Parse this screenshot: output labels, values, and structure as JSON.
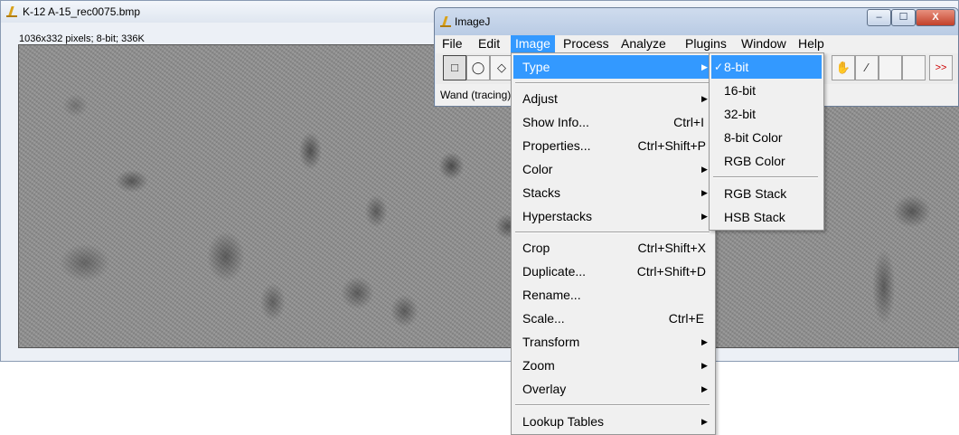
{
  "image_window": {
    "title": "K-12 A-15_rec0075.bmp",
    "info": "1036x332 pixels; 8-bit; 336K"
  },
  "imagej_window": {
    "title": "ImageJ",
    "controls": {
      "minimize": "–",
      "maximize": "☐",
      "close": "X"
    },
    "menu": [
      "File",
      "Edit",
      "Image",
      "Process",
      "Analyze",
      "Plugins",
      "Window",
      "Help"
    ],
    "active_menu": "Image",
    "tools": [
      {
        "name": "rectangle-tool",
        "glyph": "□",
        "selected": true
      },
      {
        "name": "oval-tool",
        "glyph": "◯"
      },
      {
        "name": "polygon-tool",
        "glyph": "◇"
      },
      {
        "name": "hand-tool",
        "glyph": "✋"
      },
      {
        "name": "dropper-tool",
        "glyph": "⁄"
      },
      {
        "name": "blank-tool-1",
        "glyph": ""
      },
      {
        "name": "blank-tool-2",
        "glyph": ""
      },
      {
        "name": "more-tools",
        "glyph": ">>",
        "color": "#cc0000"
      }
    ],
    "status": "Wand (tracing) tool"
  },
  "image_menu": {
    "items": [
      {
        "label": "Type",
        "submenu": true,
        "highlighted": true
      },
      {
        "separator": true
      },
      {
        "label": "Adjust",
        "submenu": true
      },
      {
        "label": "Show Info...",
        "shortcut": "Ctrl+I"
      },
      {
        "label": "Properties...",
        "shortcut": "Ctrl+Shift+P"
      },
      {
        "label": "Color",
        "submenu": true
      },
      {
        "label": "Stacks",
        "submenu": true
      },
      {
        "label": "Hyperstacks",
        "submenu": true
      },
      {
        "separator": true
      },
      {
        "label": "Crop",
        "shortcut": "Ctrl+Shift+X"
      },
      {
        "label": "Duplicate...",
        "shortcut": "Ctrl+Shift+D"
      },
      {
        "label": "Rename..."
      },
      {
        "label": "Scale...",
        "shortcut": "Ctrl+E"
      },
      {
        "label": "Transform",
        "submenu": true
      },
      {
        "label": "Zoom",
        "submenu": true
      },
      {
        "label": "Overlay",
        "submenu": true
      },
      {
        "separator": true
      },
      {
        "label": "Lookup Tables",
        "submenu": true
      }
    ]
  },
  "type_submenu": {
    "items": [
      {
        "label": "8-bit",
        "checked": true,
        "highlighted": true
      },
      {
        "label": "16-bit"
      },
      {
        "label": "32-bit"
      },
      {
        "label": "8-bit Color"
      },
      {
        "label": "RGB Color"
      },
      {
        "separator": true
      },
      {
        "label": "RGB Stack"
      },
      {
        "label": "HSB Stack"
      }
    ]
  },
  "glyphs": {
    "submenu_arrow": "▶",
    "check": "✓"
  },
  "colors": {
    "highlight": "#3399ff",
    "menu_bg": "#f0f0f0"
  }
}
